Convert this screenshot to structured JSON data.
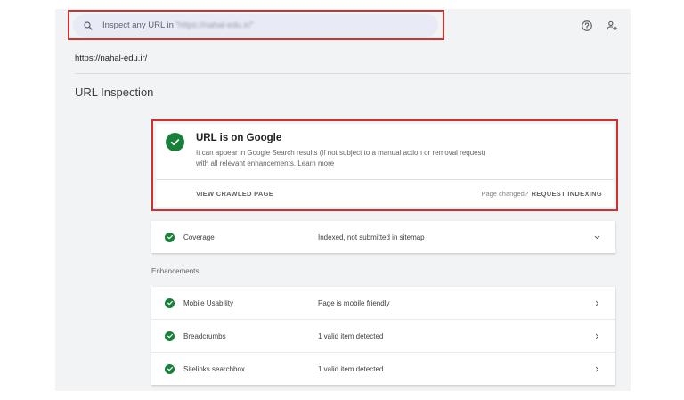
{
  "search": {
    "placeholder": "Inspect any URL in",
    "property_blurred": "\"https://nahal-edu.ir/\""
  },
  "property_url": "https://nahal-edu.ir/",
  "page_title": "URL Inspection",
  "status": {
    "heading": "URL is on Google",
    "description": "It can appear in Google Search results (if not subject to a manual action or removal request) with all relevant enhancements.",
    "learn_more": "Learn more",
    "view_crawled": "VIEW CRAWLED PAGE",
    "page_changed": "Page changed?",
    "request_indexing": "REQUEST INDEXING"
  },
  "coverage": {
    "name": "Coverage",
    "value": "Indexed, not submitted in sitemap"
  },
  "enhancements_label": "Enhancements",
  "enhancements": [
    {
      "name": "Mobile Usability",
      "value": "Page is mobile friendly"
    },
    {
      "name": "Breadcrumbs",
      "value": "1 valid item detected"
    },
    {
      "name": "Sitelinks searchbox",
      "value": "1 valid item detected"
    }
  ],
  "icons": {
    "search": "search-icon",
    "help": "help-icon",
    "account_settings": "manage-account-icon",
    "status_check": "check-circle-icon",
    "expand": "chevron-down-icon",
    "open": "chevron-right-icon"
  },
  "colors": {
    "success_green": "#188038",
    "highlight_red": "#d32f2f",
    "frame_bg": "#f1f3f4",
    "search_bg": "#e8eaf6"
  }
}
